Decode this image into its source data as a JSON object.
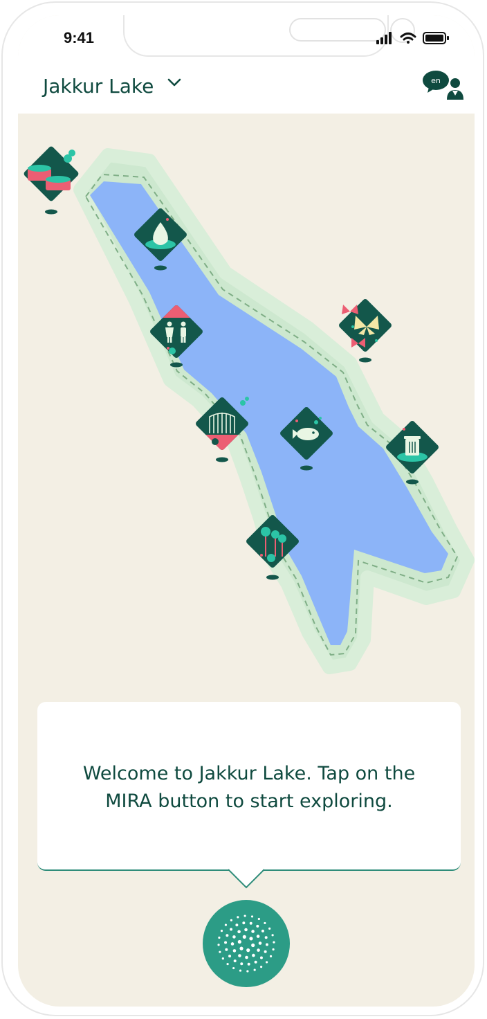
{
  "status_bar": {
    "time": "9:41"
  },
  "header": {
    "title": "Jakkur Lake",
    "language": "en"
  },
  "map": {
    "markers": [
      {
        "name": "pipes-marker"
      },
      {
        "name": "water-drop-marker"
      },
      {
        "name": "restroom-marker"
      },
      {
        "name": "butterflies-marker"
      },
      {
        "name": "gate-marker"
      },
      {
        "name": "fish-marker"
      },
      {
        "name": "trash-bin-marker"
      },
      {
        "name": "trees-marker"
      }
    ]
  },
  "welcome_card": {
    "text": "Welcome to Jakkur Lake. Tap on the MIRA button to start exploring."
  },
  "mira_button": {
    "icon": "dots-burst-icon"
  },
  "colors": {
    "accent": "#2c9c86",
    "header_text": "#0f4a3f",
    "marker_bg": "#13574b",
    "marker_pink": "#ec5e73",
    "lake": "#8cb4f8",
    "shore": "#cde8cf",
    "background": "#f3efe4"
  }
}
